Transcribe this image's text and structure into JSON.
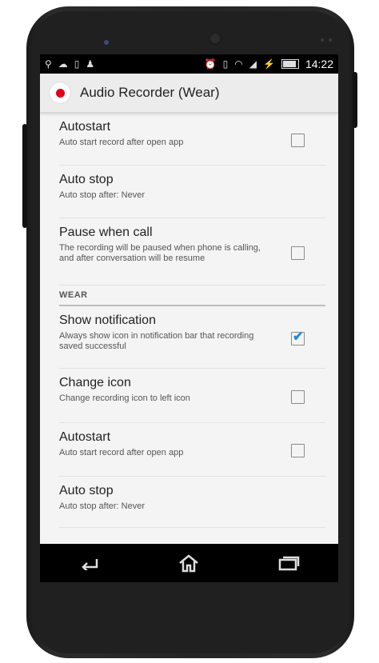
{
  "statusbar": {
    "time": "14:22",
    "left_icons": [
      "usb-icon",
      "cloud-upload-icon",
      "phone-vibrate-icon",
      "android-icon"
    ],
    "right_icons": [
      "alarm-icon",
      "vibrate-icon",
      "wifi-icon",
      "signal-icon",
      "no-sim-icon",
      "battery-icon"
    ],
    "battery_level": 0.9
  },
  "actionbar": {
    "title": "Audio Recorder (Wear)",
    "icon": "record-dot-icon",
    "icon_color": "#e3001b"
  },
  "settings": [
    {
      "type": "item",
      "title": "Autostart",
      "summary": "Auto start record after open app",
      "checkbox": true,
      "checked": false
    },
    {
      "type": "item",
      "title": "Auto stop",
      "summary": "Auto stop after: Never",
      "checkbox": false
    },
    {
      "type": "item",
      "title": "Pause when call",
      "summary": "The recording will be paused when phone is calling, and after conversation will be resume",
      "checkbox": true,
      "checked": false
    },
    {
      "type": "category",
      "title": "WEAR"
    },
    {
      "type": "item",
      "title": "Show notification",
      "summary": "Always show icon in notification bar that recording saved successful",
      "checkbox": true,
      "checked": true
    },
    {
      "type": "item",
      "title": "Change icon",
      "summary": "Change recording icon to left icon",
      "checkbox": true,
      "checked": false
    },
    {
      "type": "item",
      "title": "Autostart",
      "summary": "Auto start record after open app",
      "checkbox": true,
      "checked": false
    },
    {
      "type": "item",
      "title": "Auto stop",
      "summary": "Auto stop after: Never",
      "checkbox": false
    }
  ],
  "navbar": {
    "buttons": [
      "back-icon",
      "home-icon",
      "recent-apps-icon"
    ]
  },
  "colors": {
    "accent": "#1e8bd6",
    "record": "#e3001b"
  }
}
